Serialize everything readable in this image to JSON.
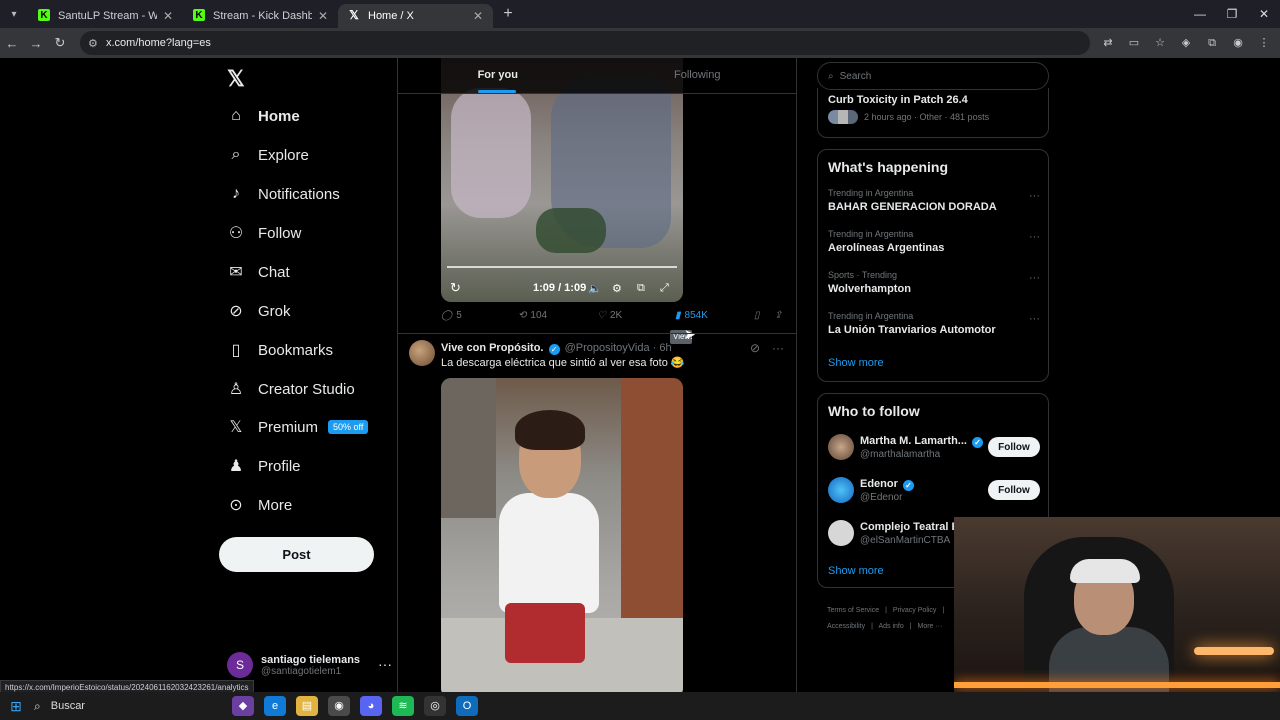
{
  "browser": {
    "tabs": [
      {
        "title": "SantuLP Stream - Watch Live on",
        "icon": "kick-icon",
        "active": false
      },
      {
        "title": "Stream - Kick Dashboard",
        "icon": "kick-icon",
        "active": false
      },
      {
        "title": "Home / X",
        "icon": "x-icon",
        "active": true
      }
    ],
    "url": "x.com/home?lang=es",
    "status_url": "https://x.com/ImperioEstoico/status/2024061162032423261/analytics"
  },
  "nav": {
    "items": [
      {
        "label": "Home",
        "icon": "home-icon"
      },
      {
        "label": "Explore",
        "icon": "search-icon"
      },
      {
        "label": "Notifications",
        "icon": "bell-icon"
      },
      {
        "label": "Follow",
        "icon": "person-add-icon"
      },
      {
        "label": "Chat",
        "icon": "mail-icon"
      },
      {
        "label": "Grok",
        "icon": "grok-icon"
      },
      {
        "label": "Bookmarks",
        "icon": "bookmark-icon"
      },
      {
        "label": "Creator Studio",
        "icon": "creator-icon"
      },
      {
        "label": "Premium",
        "icon": "x-icon"
      },
      {
        "label": "Profile",
        "icon": "profile-icon"
      },
      {
        "label": "More",
        "icon": "more-icon"
      }
    ],
    "premium_badge": "50% off",
    "post_button": "Post",
    "account": {
      "initial": "S",
      "name": "santiago tielemans",
      "handle": "@santiagotielem1"
    }
  },
  "timeline": {
    "tabs": [
      "For you",
      "Following"
    ],
    "post1": {
      "video_time": "1:09 / 1:09",
      "replies": "5",
      "reposts": "104",
      "likes": "2K",
      "views": "854K",
      "tooltip": "Views"
    },
    "post2": {
      "name": "Vive con Propósito.",
      "handle": "@PropositoyVida",
      "time": "· 6h",
      "text": "La descarga eléctrica que sintió al ver esa foto 😂"
    }
  },
  "sidebar": {
    "search_placeholder": "Search",
    "top_trend": {
      "title": "Curb Toxicity in Patch 26.4",
      "meta": "2 hours ago · Other · 481 posts"
    },
    "happening_title": "What's happening",
    "trends": [
      {
        "category": "Trending in Argentina",
        "name": "BAHAR GENERACION DORADA"
      },
      {
        "category": "Trending in Argentina",
        "name": "Aerolíneas Argentinas"
      },
      {
        "category": "Sports · Trending",
        "name": "Wolverhampton"
      },
      {
        "category": "Trending in Argentina",
        "name": "La Unión Tranviarios Automotor"
      }
    ],
    "show_more": "Show more",
    "who_to_follow_title": "Who to follow",
    "who_to_follow": [
      {
        "name": "Martha M. Lamarth...",
        "handle": "@marthalamartha",
        "button": "Follow"
      },
      {
        "name": "Edenor",
        "handle": "@Edenor",
        "button": "Follow"
      },
      {
        "name": "Complejo Teatral Ba",
        "handle": "@elSanMartinCTBA",
        "button": ""
      }
    ],
    "footer": [
      "Terms of Service",
      "|",
      "Privacy Policy",
      "|",
      "Accessibility",
      "|",
      "Ads info",
      "|",
      "More ···"
    ]
  },
  "taskbar": {
    "search_label": "Buscar"
  }
}
